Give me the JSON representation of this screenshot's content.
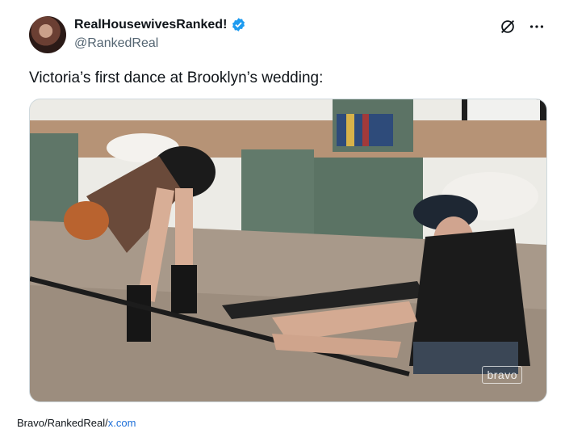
{
  "author": {
    "display_name": "RealHousewivesRanked!",
    "handle": "@RankedReal",
    "verified_icon": "verified-badge-icon"
  },
  "actions": {
    "icons": [
      "grok-icon",
      "more-icon"
    ]
  },
  "tweet": {
    "text": "Victoria’s first dance at Brooklyn’s wedding:"
  },
  "media": {
    "watermark": "bravo"
  },
  "source": {
    "prefix": "Bravo/RankedReal/",
    "link": "x.com"
  },
  "colors": {
    "verified": "#1d9bf0",
    "link": "#1d6fd8",
    "secondary_text": "#536471"
  }
}
